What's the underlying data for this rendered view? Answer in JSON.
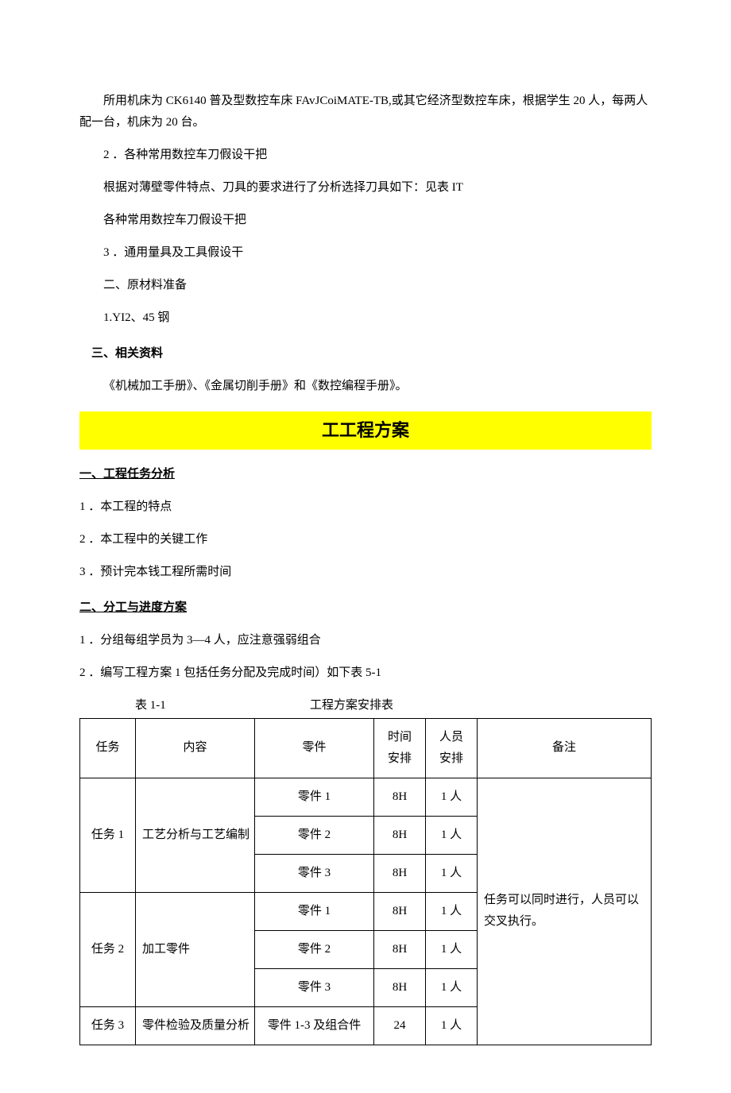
{
  "intro": {
    "p1": "所用机床为 CK6140 普及型数控车床 FAvJCoiMATE-TB,或其它经济型数控车床，根据学生 20 人，每两人配一台，机床为 20 台。",
    "p2": "2 ．各种常用数控车刀假设干把",
    "p3": "根据对薄壁零件特点、刀具的要求进行了分析选择刀具如下：见表 IT",
    "p4": "各种常用数控车刀假设干把",
    "p5": "3 ．通用量具及工具假设干",
    "h_material": "二、原材料准备",
    "p6": "1.YI2、45 钢",
    "h_res": "三、相关资料",
    "p7": "《机械加工手册》、《金属切削手册》和《数控编程手册》。"
  },
  "banner": "工工程方案",
  "sec1": {
    "head": "一、工程任务分析",
    "i1": "1 ．本工程的特点",
    "i2": "2 ．本工程中的关键工作",
    "i3": "3 ．预计完本钱工程所需时间"
  },
  "sec2": {
    "head": "二、分工与进度方案",
    "i1": "1 ．分组每组学员为 3—4 人，应注意强弱组合",
    "i2": "2 ．编写工程方案 1 包括任务分配及完成时间）如下表 5-1"
  },
  "table": {
    "caption_left": "表 1-1",
    "caption_right": "工程方案安排表",
    "headers": {
      "task": "任务",
      "content": "内容",
      "part": "零件",
      "time_l1": "时间",
      "time_l2": "安排",
      "person_l1": "人员",
      "person_l2": "安排",
      "note": "备注"
    },
    "r1": {
      "task": "任务 1",
      "content": "工艺分析与工艺编制",
      "p1": "零件 1",
      "t1": "8H",
      "n1": "1 人",
      "p2": "零件 2",
      "t2": "8H",
      "n2": "1 人",
      "p3": "零件 3",
      "t3": "8H",
      "n3": "1 人"
    },
    "r2": {
      "task": "任务 2",
      "content": "加工零件",
      "p1": "零件 1",
      "t1": "8H",
      "n1": "1 人",
      "p2": "零件 2",
      "t2": "8H",
      "n2": "1 人",
      "p3": "零件 3",
      "t3": "8H",
      "n3": "1 人"
    },
    "r3": {
      "task": "任务 3",
      "content": "零件检验及质量分析",
      "part": "零件 1-3 及组合件",
      "time": "24",
      "person": "1 人"
    },
    "note_merged": "任务可以同时进行，人员可以交叉执行。"
  }
}
